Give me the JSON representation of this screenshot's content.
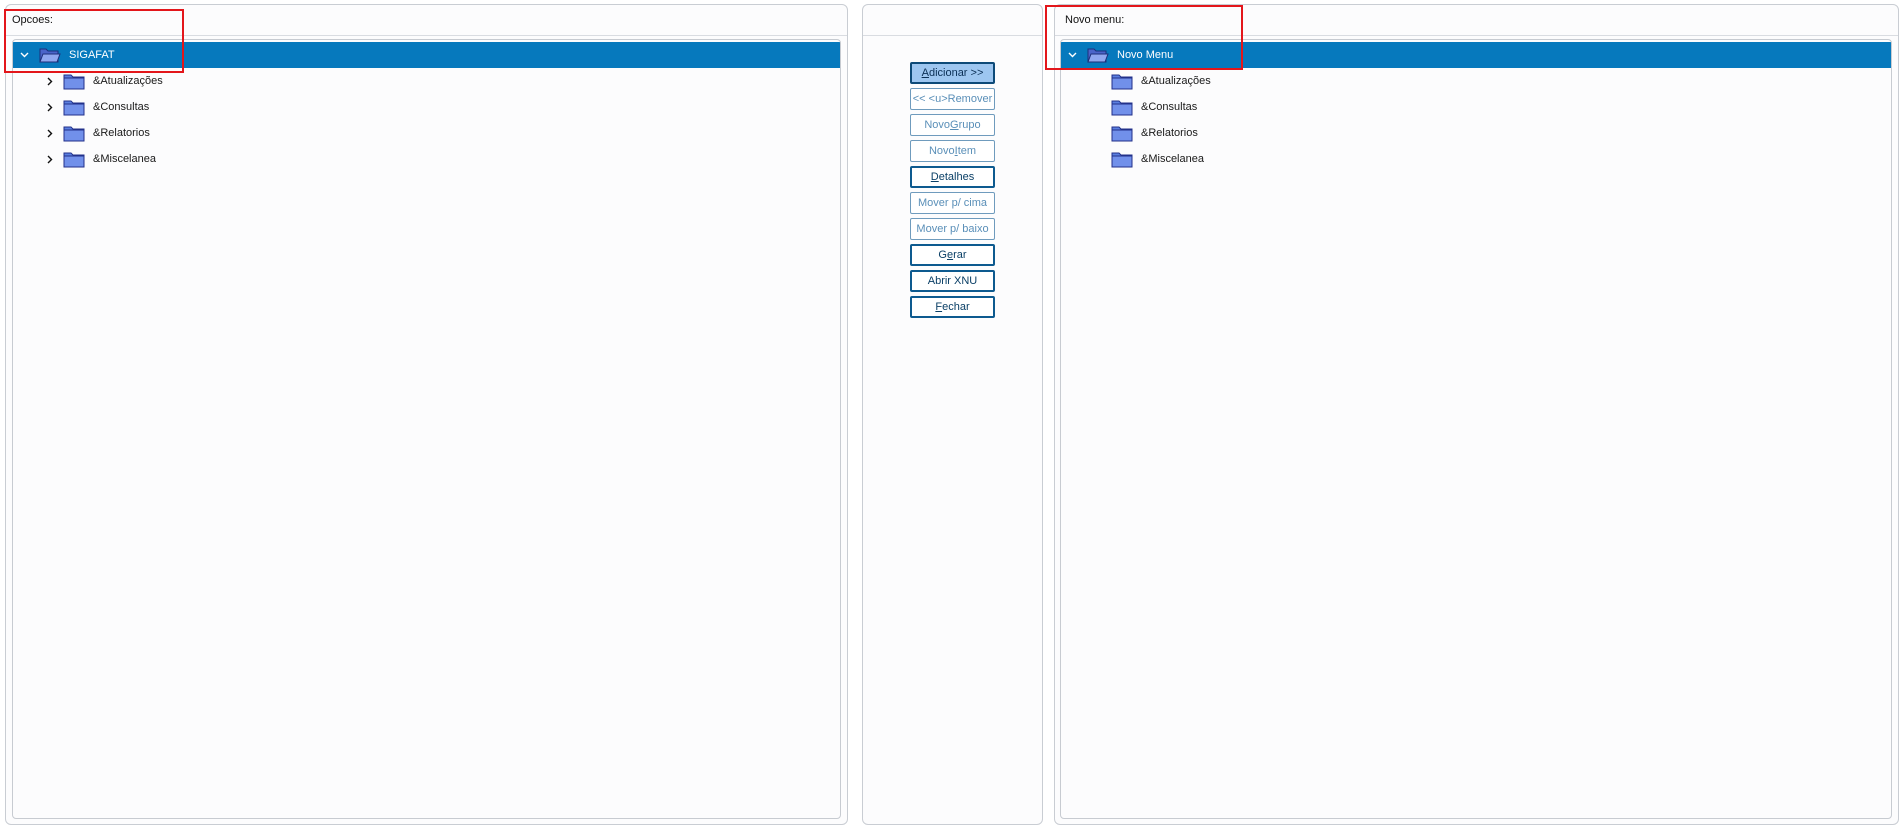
{
  "left_panel": {
    "header": "Opcoes:",
    "root": {
      "label": "SIGAFAT"
    },
    "items": [
      {
        "label": "&Atualizações"
      },
      {
        "label": "&Consultas"
      },
      {
        "label": "&Relatorios"
      },
      {
        "label": "&Miscelanea"
      }
    ]
  },
  "buttons": [
    {
      "label": "Adicionar >>",
      "underline_index": 0,
      "state": "primary"
    },
    {
      "label": "<< <u>Remover",
      "underline_index": -1,
      "state": "disabled"
    },
    {
      "label": "Novo Grupo",
      "underline_index": 5,
      "state": "disabled"
    },
    {
      "label": "Novo Item",
      "underline_index": 5,
      "state": "disabled"
    },
    {
      "label": "Detalhes",
      "underline_index": 0,
      "state": "enabled"
    },
    {
      "label": "Mover p/ cima",
      "underline_index": -1,
      "state": "disabled"
    },
    {
      "label": "Mover p/ baixo",
      "underline_index": -1,
      "state": "disabled"
    },
    {
      "label": "Gerar",
      "underline_index": 1,
      "state": "enabled"
    },
    {
      "label": "Abrir XNU",
      "underline_index": -1,
      "state": "enabled"
    },
    {
      "label": "Fechar",
      "underline_index": 0,
      "state": "enabled"
    }
  ],
  "right_panel": {
    "header": "Novo menu:",
    "root": {
      "label": "Novo Menu"
    },
    "items": [
      {
        "label": "&Atualizações"
      },
      {
        "label": "&Consultas"
      },
      {
        "label": "&Relatorios"
      },
      {
        "label": "&Miscelanea"
      }
    ]
  },
  "colors": {
    "selection": "#0679bd",
    "folder_fill": "#5b7fe0",
    "highlight_box": "#e3161b",
    "button_border": "#0d5a8f"
  }
}
